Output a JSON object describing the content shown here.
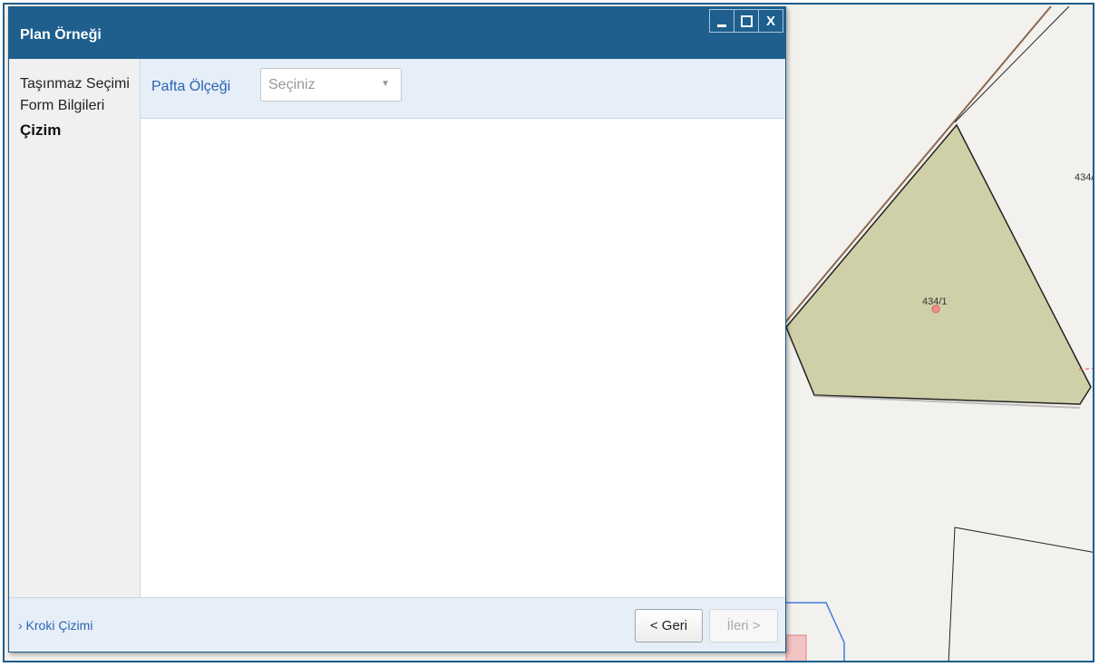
{
  "window": {
    "title": "Plan Örneği",
    "controls": {
      "close_label": "X"
    }
  },
  "nav": {
    "items": [
      {
        "label": "Taşınmaz Seçimi",
        "active": false
      },
      {
        "label": "Form Bilgileri",
        "active": false
      },
      {
        "label": "Çizim",
        "active": true
      }
    ]
  },
  "form": {
    "scale_label": "Pafta Ölçeği",
    "scale_select": {
      "value": "Seçiniz"
    }
  },
  "footer": {
    "link_label": "› Kroki Çizimi",
    "back_label": "< Geri",
    "next_label": "İleri >"
  },
  "map": {
    "parcel_label": "434/1",
    "neighbor_label": "434/",
    "colors": {
      "parcel_fill": "#d0d0a8",
      "background": "#f3f1ee",
      "accent": "#1e5f8e"
    }
  }
}
